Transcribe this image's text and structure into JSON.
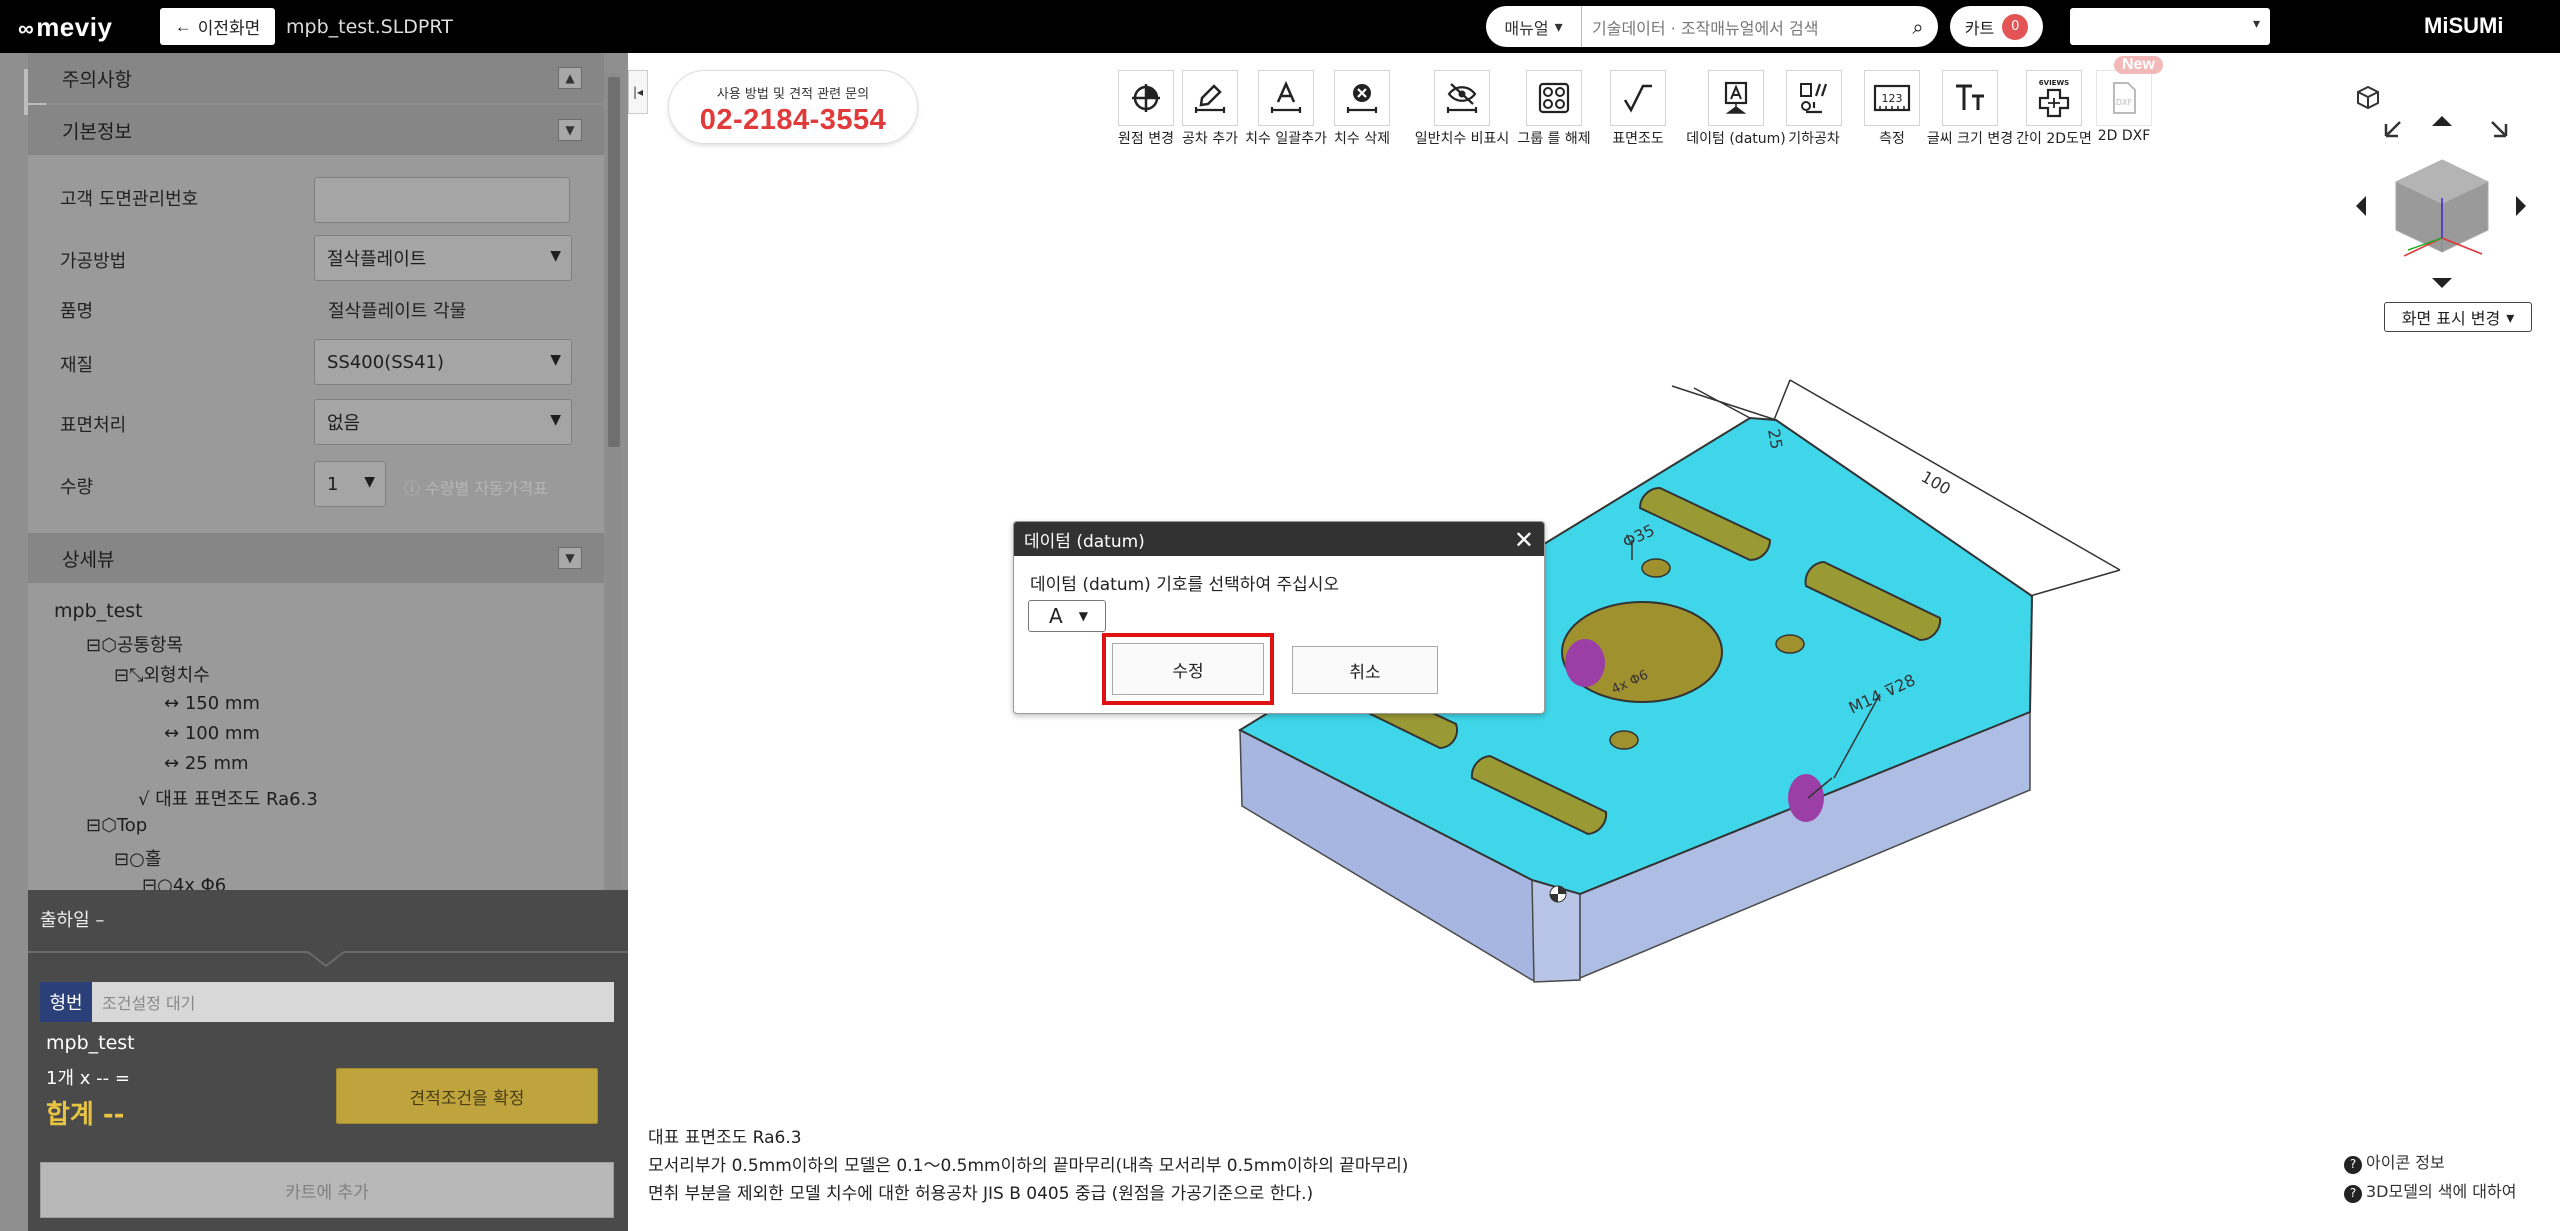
{
  "topbar": {
    "logo": "meviy",
    "back_label": "이전화면",
    "filename": "mpb_test.SLDPRT",
    "search_scope": "매뉴얼",
    "search_placeholder": "기술데이터 · 조작매뉴얼에서 검색",
    "cart_label": "카트",
    "cart_count": "0",
    "brand": "MiSUMi"
  },
  "sidebar": {
    "notice_title": "주의사항",
    "basic_title": "기본정보",
    "fields": {
      "customer_no_label": "고객 도면관리번호",
      "customer_no_value": "",
      "process_label": "가공방법",
      "process_value": "절삭플레이트",
      "product_label": "품명",
      "product_value": "절삭플레이트 각물",
      "material_label": "재질",
      "material_value": "SS400(SS41)",
      "surface_label": "표면처리",
      "surface_value": "없음",
      "qty_label": "수량",
      "qty_value": "1",
      "qty_link": "수량별 자동가격표"
    },
    "detail_title": "상세뷰",
    "tree": {
      "root": "mpb_test",
      "common": "공통항목",
      "outer": "외형치수",
      "x": "150 mm",
      "y": "100 mm",
      "z": "25 mm",
      "roughness": "대표 표면조도 Ra6.3",
      "top": "Top",
      "hole": "홀",
      "hole_item": "4x Φ6"
    }
  },
  "order": {
    "ship_label": "출하일 –",
    "type_tag": "형번",
    "type_placeholder": "조건설정 대기",
    "part_name": "mpb_test",
    "qty_line": "1개 x -- =",
    "total": "합계 --",
    "confirm_label": "견적조건을 확정",
    "addcart_label": "카트에 추가"
  },
  "contact": {
    "small": "사용 방법 및 견적 관련 문의",
    "phone": "02-2184-3554"
  },
  "toolbar": {
    "tools": [
      {
        "label": "원점 변경"
      },
      {
        "label": "공차 추가"
      },
      {
        "label": "치수 일괄추가"
      },
      {
        "label": "치수 삭제"
      },
      {
        "label": "일반치수 비표시"
      },
      {
        "label": "그룹 를 해제"
      },
      {
        "label": "표면조도"
      },
      {
        "label": "데이텀 (datum)"
      },
      {
        "label": "기하공차"
      },
      {
        "label": "측정"
      },
      {
        "label": "글씨 크기 변경"
      },
      {
        "label": "간이 2D도면"
      },
      {
        "label": "2D DXF"
      }
    ],
    "sixviews": "6VIEWS",
    "new_badge": "New"
  },
  "viewer": {
    "view_select": "화면 표시 변경",
    "dims": {
      "d100": "100",
      "d25": "25",
      "phi35": "Φ35",
      "phi6": "4x Φ6",
      "m14": "M14 ⊽28"
    }
  },
  "dialog": {
    "title": "데이텀 (datum)",
    "prompt": "데이텀 (datum) 기호를 선택하여 주십시오",
    "selected": "A",
    "edit_label": "수정",
    "cancel_label": "취소"
  },
  "notes": {
    "line1": "대표 표면조도 Ra6.3",
    "line2": "모서리부가 0.5mm이하의 모델은 0.1～0.5mm이하의 끝마무리(내측 모서리부 0.5mm이하의 끝마무리)",
    "line3": "면취 부분을 제외한 모델 치수에 대한 허용공차 JIS B 0405 중급 (원점을 가공기준으로 한다.)"
  },
  "help": {
    "icon_info": "아이콘 정보",
    "color_info": "3D모델의 색에 대하여"
  },
  "colors": {
    "topbar": "#000000",
    "part_top": "#3fd6ea",
    "part_side": "#a9b8dd",
    "slot": "#9a9a35",
    "hole_purple": "#9b3ea6",
    "phone": "#e03a3a",
    "highlight": "#e01111"
  }
}
